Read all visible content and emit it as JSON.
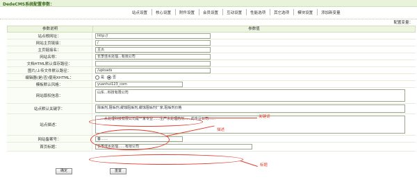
{
  "app": {
    "title": "DedeCMS系统配置参数："
  },
  "tabs": [
    "站点设置",
    "核心设置",
    "附件设置",
    "会员设置",
    "互动设置",
    "性能选项",
    "其它选项",
    "模块设置",
    "添加新变量"
  ],
  "config_var_link": "配置变量：",
  "table": {
    "col_desc": "参数说明",
    "col_value": "参数值",
    "rows": [
      {
        "label": "站点根网址：",
        "value": "http://"
      },
      {
        "label": "网站主页链接：",
        "value": "/"
      },
      {
        "label": "主页链接名：",
        "value": "主页"
      },
      {
        "label": "网站名称：",
        "value": "长李佳水处理...有限公司"
      },
      {
        "label": "文档HTML默认保存路径：",
        "value": ""
      },
      {
        "label": "图片/上传文件默认路径：",
        "value": "/uploads"
      },
      {
        "label": "编辑器(是/否)使用XHTML：",
        "options": [
          "是",
          "否"
        ],
        "selected": "否"
      },
      {
        "label": "模板默认风格：",
        "value": "yuanhui123_com"
      },
      {
        "label": "网站版权信息：",
        "value": "山东...科技有限公司"
      },
      {
        "label": "站点默认关键字：",
        "value": "除垢剂,阻垢剂,缓蚀阻垢剂,缓蚀阻垢剂厂家,阻垢剂价格"
      },
      {
        "label": "站点描述：",
        "value": "……水处理科技有限公司是一家专业……生产水处理药剂……的专业公司……"
      },
      {
        "label": "网站备案号：",
        "value": "备……"
      },
      {
        "label": "首页标题：",
        "value": "长李佳水处理……有限公司"
      }
    ]
  },
  "buttons": {
    "confirm": "确定",
    "reset": "重置"
  },
  "annotations": {
    "keywords": "关键词",
    "description": "描述",
    "title": "标题"
  },
  "colors": {
    "accent": "#e03a2a",
    "header_bg": "#edf5e1"
  }
}
